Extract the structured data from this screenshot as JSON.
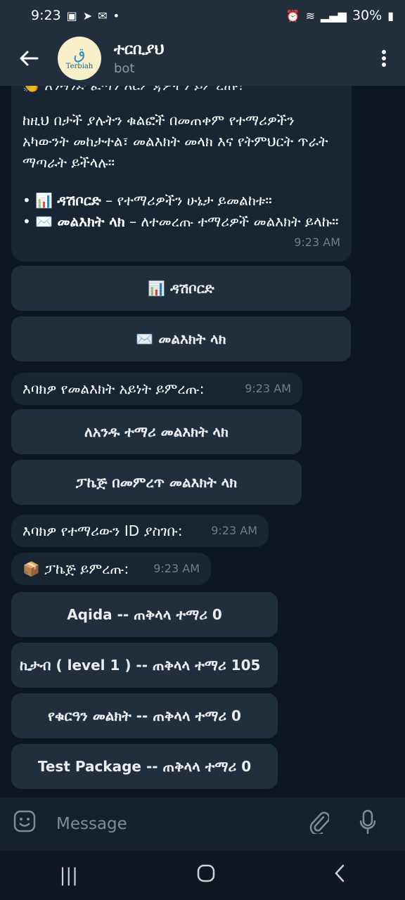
{
  "status": {
    "time": "9:23",
    "battery": "30%"
  },
  "header": {
    "title": "ተርቢያህ",
    "subtitle": "bot",
    "avatar_text": "Terbiah"
  },
  "messages": {
    "intro_cut": "አንዳንድ ፈጣን እርምጃዎችን ይምረጡ!",
    "intro_body": "ከዚህ በታች ያሉትን ቁልፎች በመጠቀም የተማሪዎችን አካውንት መከታተል፣ መልእክት መላክ እና የትምህርት ጥራት ማጣራት ይችላሉ።",
    "bullet1_title": "ዳሽቦርድ",
    "bullet1_desc": "– የተማሪዎችን ሁኔታ ይመልከቱ።",
    "bullet2_title": "መልእክት ላክ",
    "bullet2_desc": "– ለተመረጡ ተማሪዎች መልእክት ይላኩ።",
    "time1": "9:23 AM",
    "choose_type": "እባክዎ የመልእክት አይነት ይምረጡ:",
    "time2": "9:23 AM",
    "enter_id": "እባክዎ የተማሪውን ID ያስገቡ:",
    "time3": "9:23 AM",
    "choose_package": "📦 ፓኬጅ ይምረጡ:",
    "time4": "9:23 AM"
  },
  "buttons": {
    "dashboard": "📊 ዳሽቦርድ",
    "send_message": "✉️ መልእክት ላክ",
    "send_one": "ለአንዱ ተማሪ መልእክት ላክ",
    "send_package": "ፓኬጅ በመምረጥ መልእክት ላክ",
    "pkg1": "Aqida -- ጠቅላላ ተማሪ 0",
    "pkg2": "ኪታብ ( level 1 ) -- ጠቅላላ ተማሪ 105",
    "pkg3": "የቁርዓን መልክት -- ጠቅላላ ተማሪ 0",
    "pkg4": "Test Package -- ጠቅላላ ተማሪ 0"
  },
  "input": {
    "placeholder": "Message"
  },
  "icons": {
    "back": "arrow-left-icon",
    "menu": "more-vert-icon",
    "emoji": "emoji-icon",
    "attach": "paperclip-icon",
    "mic": "mic-icon"
  },
  "colors": {
    "header_bg": "#232e3c",
    "chat_bg": "#0e1621",
    "bubble_bg": "#182533",
    "button_bg": "#233140"
  }
}
